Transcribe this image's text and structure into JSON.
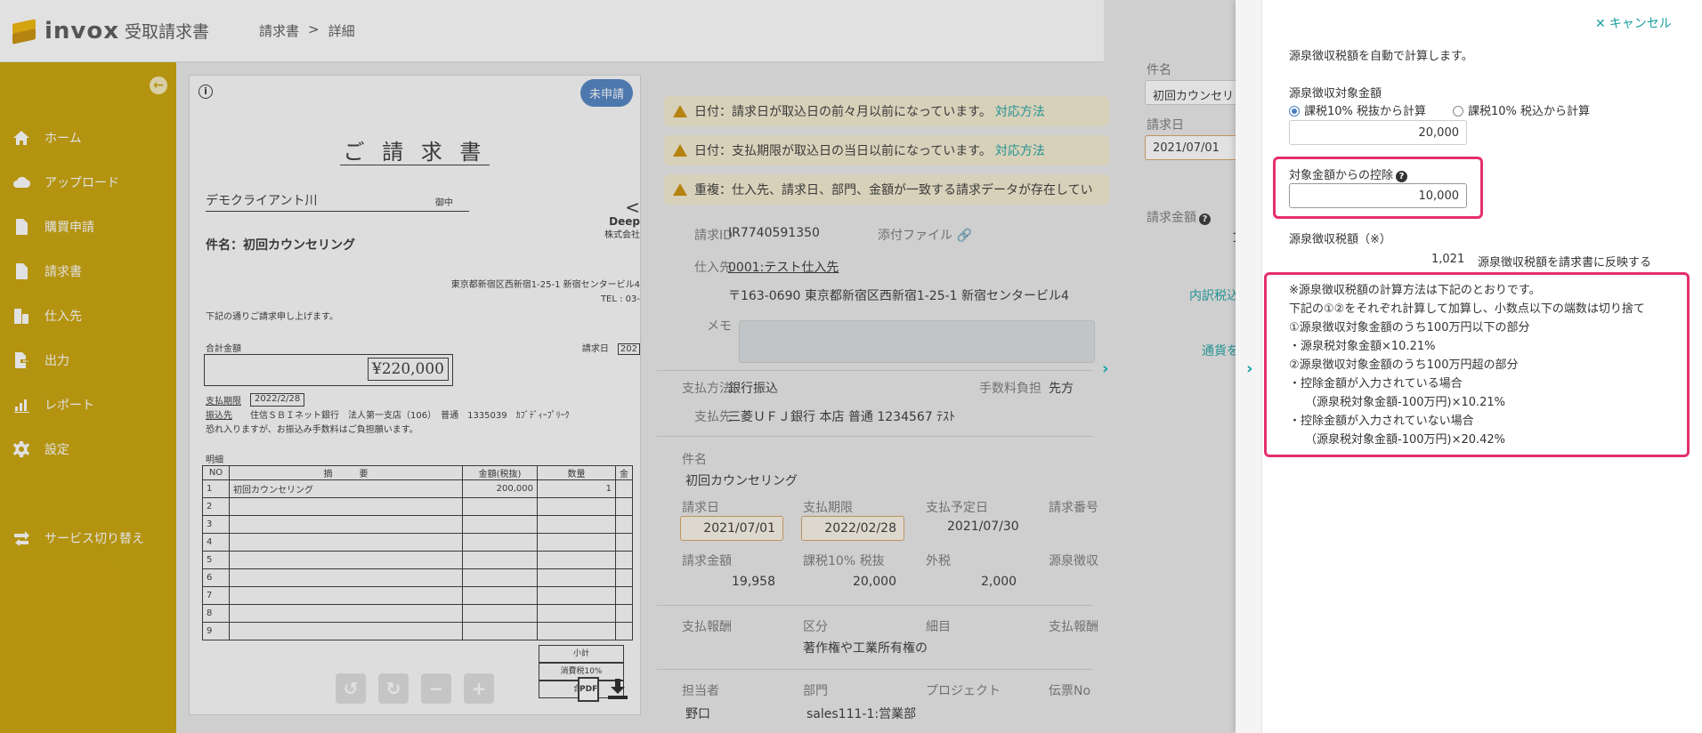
{
  "app": {
    "logo_text": "invox",
    "logo_sub": "受取請求書",
    "breadcrumb": [
      "請求書",
      ">",
      "詳細"
    ]
  },
  "sidebar": {
    "collapse_icon": "arrow-left-circle-icon",
    "items": [
      {
        "label": "ホーム",
        "icon": "home-icon"
      },
      {
        "label": "アップロード",
        "icon": "cloud-upload-icon"
      },
      {
        "label": "購買申請",
        "icon": "document-icon"
      },
      {
        "label": "請求書",
        "icon": "document-icon"
      },
      {
        "label": "仕入先",
        "icon": "building-icon"
      },
      {
        "label": "出力",
        "icon": "export-icon"
      },
      {
        "label": "レポート",
        "icon": "chart-icon"
      },
      {
        "label": "設定",
        "icon": "gear-icon"
      }
    ],
    "service_switch": "サービス切り替え",
    "colors": {
      "sidebar": "#c9a000",
      "accent": "#1aa0a0",
      "highlight": "#e4306a"
    }
  },
  "document": {
    "status_badge": "未申請",
    "title": "ご 請 求 書",
    "client": "デモクライアント川",
    "client_suffix": "御中",
    "subject": "件名：初回カウンセリング",
    "issuer_short": "Deep",
    "issuer_corp": "株式会社",
    "issuer_address": "東京都新宿区西新宿1-25-1 新宿センタービル4",
    "issuer_tel": "TEL : 03-",
    "note": "下記の通りご請求申し上げます。",
    "total_label": "合計金額",
    "date_label": "請求日",
    "date_value": "202",
    "total_amount": "¥220,000",
    "due_label": "支払期限",
    "due_value": "2022/2/28",
    "bank_label": "振込先",
    "bank_value": "住信ＳＢＩネット銀行　法人第一支店（106）　普通　1335039　ｶﾌﾞﾃﾞｨｰﾌﾟﾘｰｸ",
    "apology": "恐れ入りますが、お振込み手数料はご負担願います。",
    "meisai": "明細",
    "table_headers": [
      "NO",
      "摘　　　要",
      "金額(税抜)",
      "数量",
      "金"
    ],
    "table_rows": [
      [
        "1",
        "初回カウンセリング",
        "200,000",
        "1",
        ""
      ],
      [
        "2",
        "",
        "",
        "",
        ""
      ],
      [
        "3",
        "",
        "",
        "",
        ""
      ],
      [
        "4",
        "",
        "",
        "",
        ""
      ],
      [
        "5",
        "",
        "",
        "",
        ""
      ],
      [
        "6",
        "",
        "",
        "",
        ""
      ],
      [
        "7",
        "",
        "",
        "",
        ""
      ],
      [
        "8",
        "",
        "",
        "",
        ""
      ],
      [
        "9",
        "",
        "",
        "",
        ""
      ]
    ],
    "subtotal_labels": [
      "小計",
      "消費税10%",
      "合計"
    ],
    "pdf_label": "PDF"
  },
  "detail": {
    "warnings": [
      {
        "text": "日付：請求日が取込日の前々月以前になっています。",
        "link": "対応方法"
      },
      {
        "text": "日付：支払期限が取込日の当日以前になっています。",
        "link": "対応方法"
      },
      {
        "text": "重複：仕入先、請求日、部門、金額が一致する請求データが存在してい",
        "link": ""
      }
    ],
    "invoice_id_label": "請求ID",
    "invoice_id": "IR7740591350",
    "attachment_label": "添付ファイル",
    "supplier_label": "仕入先",
    "supplier": "0001:テスト仕入先",
    "supplier_addr": "〒163-0690 東京都新宿区西新宿1-25-1 新宿センタービル4",
    "memo_label": "メモ",
    "pay_method_label": "支払方法",
    "pay_method": "銀行振込",
    "fee_label": "手数料負担",
    "fee": "先方",
    "pay_to_label": "支払先",
    "pay_to": "三菱ＵＦＪ銀行 本店 普通 1234567 ﾃｽﾄ",
    "subject_label": "件名",
    "subject": "初回カウンセリング",
    "date_label": "請求日",
    "date": "2021/07/01",
    "due_label": "支払期限",
    "due": "2022/02/28",
    "plan_label": "支払予定日",
    "plan": "2021/07/30",
    "invno_label": "請求番号",
    "amount_label": "請求金額",
    "amount": "19,958",
    "tax10_label": "課税10% 税抜",
    "tax10": "20,000",
    "ext_tax_label": "外税",
    "ext_tax": "2,000",
    "withhold_label": "源泉徴収",
    "reward_label": "支払報酬",
    "category_label": "区分",
    "category": "著作権や工業所有権の",
    "sub_label": "細目",
    "reward2_label": "支払報酬",
    "person_label": "担当者",
    "person": "野口",
    "dept_label": "部門",
    "dept": "sales111-1:営業部",
    "project_label": "プロジェクト",
    "slip_label": "伝票No",
    "toolbar": [
      "↺",
      "↻",
      "−",
      "+"
    ]
  },
  "midpanel": {
    "subject_label": "件名",
    "subject_value": "初回カウンセリ",
    "date_label": "請求日",
    "date_value": "2021/07/01",
    "amount_label": "請求金額",
    "amount_digit": "1",
    "breakdown_link": "内訳税込",
    "currency_link": "通貨を"
  },
  "drawer": {
    "cancel_label": "キャンセル",
    "auto_calc_text": "源泉徴収税額を自動で計算します。",
    "target_label": "源泉徴収対象金額",
    "radio_excl": "課税10% 税抜から計算",
    "radio_incl": "課税10% 税込から計算",
    "target_value": "20,000",
    "deduction_label": "対象金額からの控除",
    "deduction_value": "10,000",
    "tax_label": "源泉徴収税額（※）",
    "tax_value": "1,021",
    "reflect_link": "源泉徴収税額を請求書に反映する",
    "notes": [
      "※源泉徴収税額の計算方法は下記のとおりです。",
      "下記の①②をそれぞれ計算して加算し、小数点以下の端数は切り捨て",
      "①源泉徴収対象金額のうち100万円以下の部分",
      "・源泉税対象金額×10.21%",
      "②源泉徴収対象金額のうち100万円超の部分",
      "・控除金額が入力されている場合",
      "（源泉税対象金額-100万円)×10.21%",
      "・控除金額が入力されていない場合",
      "（源泉税対象金額-100万円)×20.42%"
    ]
  }
}
